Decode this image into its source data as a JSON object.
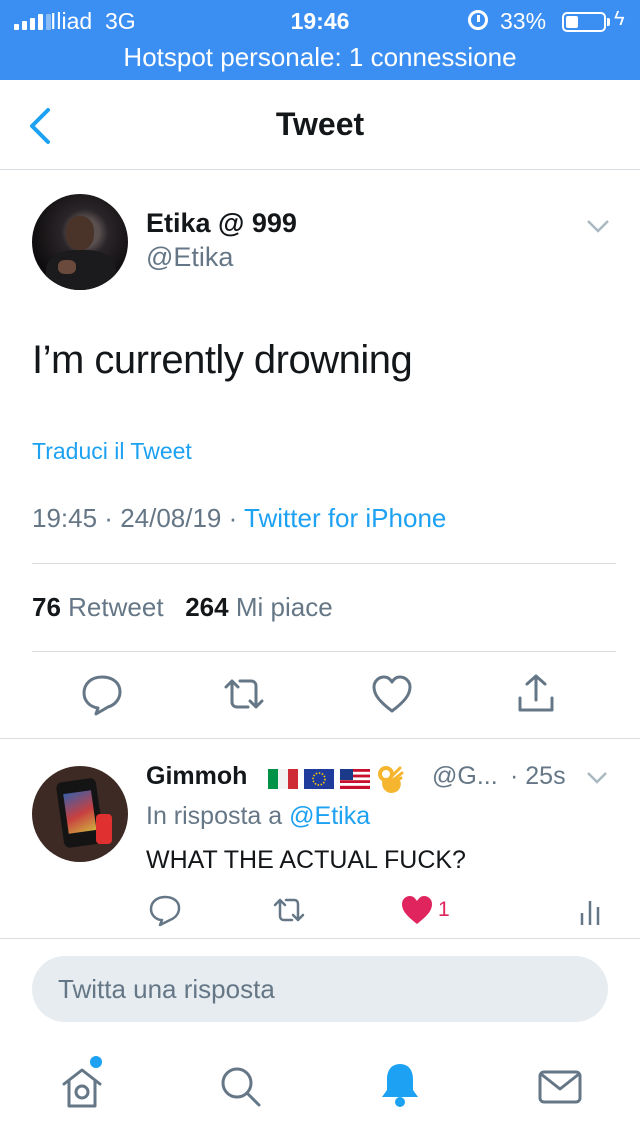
{
  "status_bar": {
    "carrier": "Iliad",
    "network": "3G",
    "time": "19:46",
    "battery_percent": "33%",
    "battery_level": 0.33,
    "hotspot": "Hotspot personale: 1 connessione",
    "color": "#3b8ff2"
  },
  "nav": {
    "title": "Tweet",
    "back_icon": "chevron-left-icon"
  },
  "tweet": {
    "author_name": "Etika @ 999",
    "author_handle": "@Etika",
    "text": "I’m currently drowning",
    "translate": "Traduci il Tweet",
    "time": "19:45",
    "date": "24/08/19",
    "source": "Twitter for iPhone",
    "retweets": "76",
    "retweet_label": "Retweet",
    "likes": "264",
    "likes_label": "Mi piace"
  },
  "reply": {
    "author_name": "Gimmoh",
    "flags": [
      "italy-flag",
      "eu-flag",
      "usa-flag",
      "ok-hand-emoji"
    ],
    "handle": "@G...",
    "time": "· 25s",
    "reply_prefix": "In risposta a",
    "reply_mention": "@Etika",
    "text": "WHAT THE ACTUAL FUCK?",
    "like_count": "1"
  },
  "compose": {
    "placeholder": "Twitta una risposta"
  },
  "tabbar": [
    "home-icon",
    "search-icon",
    "notifications-icon",
    "messages-icon"
  ],
  "colors": {
    "accent": "#1da1f2",
    "secondary_text": "#657786",
    "like": "#e0245e"
  }
}
